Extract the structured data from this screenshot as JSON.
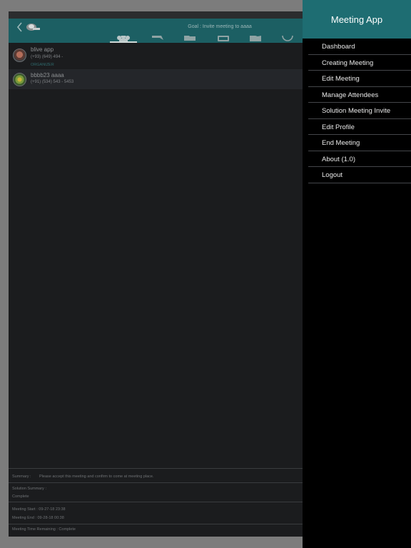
{
  "colors": {
    "header_teal": "#1c5f63",
    "drawer_header_teal": "#1e6d72",
    "drawer_background": "#000000",
    "app_background": "#1b1c1e",
    "dimmed_overlay": "#7c7c7c"
  },
  "navbar": {
    "back_icon": "chevron-left-icon",
    "logo_icon": "app-logo-icon",
    "goal": "Goal : Invite meeting to aaaa"
  },
  "tabs": [
    {
      "icon": "attendees-icon",
      "selected": true
    },
    {
      "icon": "chat-icon",
      "selected": false
    },
    {
      "icon": "folder-icon",
      "selected": false
    },
    {
      "icon": "tablet-icon",
      "selected": false
    },
    {
      "icon": "map-icon",
      "selected": false
    },
    {
      "icon": "clock-icon",
      "selected": false
    }
  ],
  "attendees": [
    {
      "name": "blive app",
      "phone": "(+93) (649) 494 -",
      "role": "ORGANIZER"
    },
    {
      "name": "bbbb23 aaaa",
      "phone": "(+91) (534) 543 - 5453",
      "role": ""
    }
  ],
  "bottom": {
    "summary_label": "Summary :",
    "summary_text": "Please accept this meeting and confirm to come at meeting place.",
    "solution_label": "Solution Summary :",
    "solution_value": "Complete",
    "meeting_start": "Meeting Start : 09-27-18 23:38",
    "meeting_end": "Meeting End : 09-28-18 00:38",
    "time_remaining": "Meeting Time Remaining : Complete"
  },
  "drawer": {
    "title": "Meeting App",
    "menu": [
      {
        "label": "Dashboard"
      },
      {
        "label": "Creating Meeting"
      },
      {
        "label": "Edit Meeting"
      },
      {
        "label": "Manage Attendees"
      },
      {
        "label": "Solution Meeting Invite"
      },
      {
        "label": "Edit Profile"
      },
      {
        "label": "End Meeting"
      },
      {
        "label": "About (1.0)"
      },
      {
        "label": "Logout"
      }
    ]
  }
}
